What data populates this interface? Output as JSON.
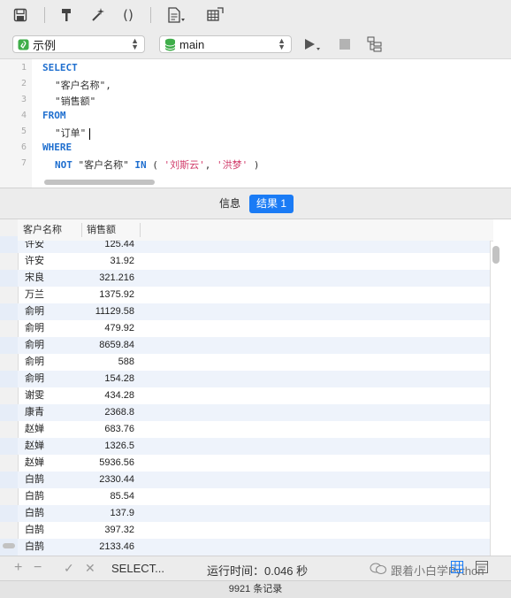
{
  "toolbar": {
    "icons": [
      "save-icon",
      "build-icon",
      "magic-wand-icon",
      "parentheses-icon",
      "document-icon",
      "export-icon"
    ],
    "parens_glyph": "()"
  },
  "connection": {
    "database_label": "示例",
    "schema_label": "main"
  },
  "editor": {
    "line_numbers": [
      "1",
      "2",
      "3",
      "4",
      "5",
      "6",
      "7"
    ],
    "lines": [
      {
        "kw": "SELECT",
        "rest": ""
      },
      {
        "kw": "",
        "rest": "\"客户名称\","
      },
      {
        "kw": "",
        "rest": "\"销售额\""
      },
      {
        "kw": "FROM",
        "rest": ""
      },
      {
        "kw": "",
        "rest": "\"订单\""
      },
      {
        "kw": "WHERE",
        "rest": ""
      },
      {
        "kw": "NOT",
        "rest": "\"客户名称\""
      }
    ],
    "line7_in": "IN",
    "line7_open": "(",
    "line7_v1": "'刘斯云'",
    "line7_comma": ",",
    "line7_v2": "'洪梦'",
    "line7_close": ")"
  },
  "tabs": {
    "info": "信息",
    "result": "结果 1"
  },
  "grid": {
    "columns": [
      "客户名称",
      "销售额"
    ],
    "rows": [
      [
        "许安",
        "125.44"
      ],
      [
        "许安",
        "31.92"
      ],
      [
        "宋良",
        "321.216"
      ],
      [
        "万兰",
        "1375.92"
      ],
      [
        "俞明",
        "11129.58"
      ],
      [
        "俞明",
        "479.92"
      ],
      [
        "俞明",
        "8659.84"
      ],
      [
        "俞明",
        "588"
      ],
      [
        "俞明",
        "154.28"
      ],
      [
        "谢雯",
        "434.28"
      ],
      [
        "康青",
        "2368.8"
      ],
      [
        "赵婵",
        "683.76"
      ],
      [
        "赵婵",
        "1326.5"
      ],
      [
        "赵婵",
        "5936.56"
      ],
      [
        "白鹄",
        "2330.44"
      ],
      [
        "白鹄",
        "85.54"
      ],
      [
        "白鹄",
        "137.9"
      ],
      [
        "白鹄",
        "397.32"
      ],
      [
        "白鹄",
        "2133.46"
      ]
    ]
  },
  "bottombar": {
    "add": "+",
    "remove": "−",
    "confirm": "✓",
    "cancel": "✕",
    "query_preview": "SELECT...",
    "runtime": "运行时间：0.046 秒",
    "watermark": "跟着小白学Python"
  },
  "status": {
    "record_count": "9921 条记录"
  }
}
